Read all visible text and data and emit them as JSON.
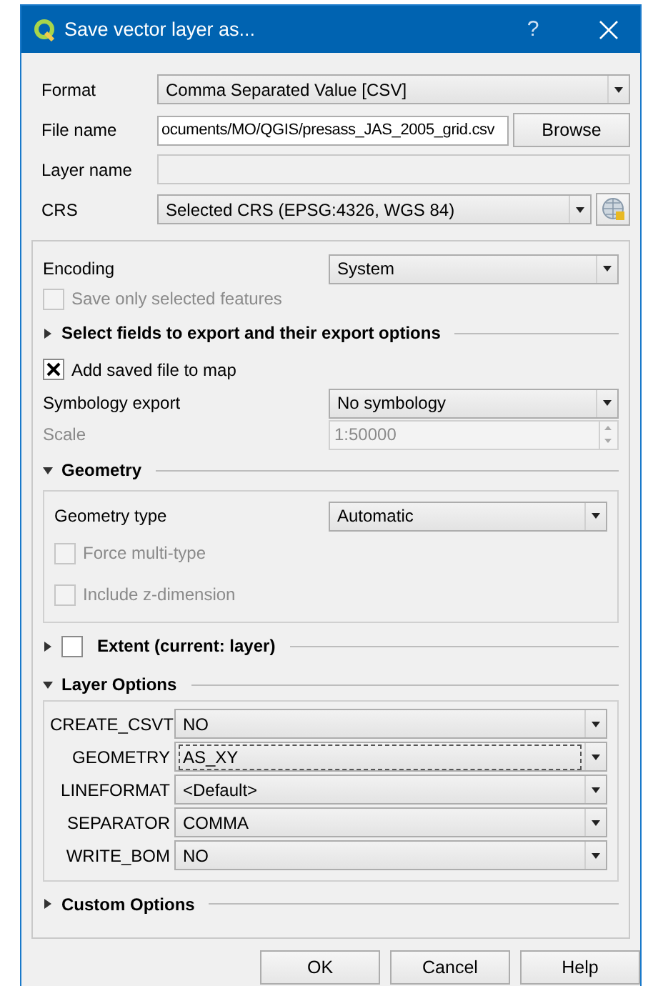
{
  "window": {
    "title": "Save vector layer as...",
    "help": "?"
  },
  "format": {
    "label": "Format",
    "value": "Comma Separated Value [CSV]"
  },
  "file_name": {
    "label": "File name",
    "value": "ocuments/MO/QGIS/presass_JAS_2005_grid.csv",
    "button": "Browse"
  },
  "layer_name": {
    "label": "Layer name",
    "disabled": true
  },
  "crs": {
    "label": "CRS",
    "value": "Selected CRS (EPSG:4326, WGS 84)"
  },
  "encoding": {
    "label": "Encoding",
    "value": "System"
  },
  "save_only_selected": {
    "label": "Save only selected features",
    "checked": false,
    "disabled": true
  },
  "select_fields": {
    "title": "Select fields to export and their export options",
    "expanded": false
  },
  "add_saved_file": {
    "label": "Add saved file to map",
    "checked": true,
    "disabled": false
  },
  "symbology_export": {
    "label": "Symbology export",
    "value": "No symbology"
  },
  "scale": {
    "label": "Scale",
    "value": "1:50000",
    "disabled": true
  },
  "geometry": {
    "title": "Geometry",
    "expanded": true,
    "geometry_type": {
      "label": "Geometry type",
      "value": "Automatic"
    },
    "options": [
      {
        "label": "Force multi-type",
        "checked": false,
        "disabled": true
      },
      {
        "label": "Include z-dimension",
        "checked": false,
        "disabled": true
      }
    ]
  },
  "extent": {
    "title": "Extent (current: layer)",
    "expanded": false,
    "checked": false
  },
  "layer_options": {
    "title": "Layer Options",
    "expanded": true,
    "rows": [
      {
        "name": "CREATE_CSVT",
        "value": "NO",
        "focused": false
      },
      {
        "name": "GEOMETRY",
        "value": "AS_XY",
        "focused": true
      },
      {
        "name": "LINEFORMAT",
        "value": "<Default>",
        "focused": false
      },
      {
        "name": "SEPARATOR",
        "value": "COMMA",
        "focused": false
      },
      {
        "name": "WRITE_BOM",
        "value": "NO",
        "focused": false
      }
    ]
  },
  "custom_options": {
    "title": "Custom Options",
    "expanded": false
  },
  "buttons": [
    "OK",
    "Cancel",
    "Help"
  ]
}
